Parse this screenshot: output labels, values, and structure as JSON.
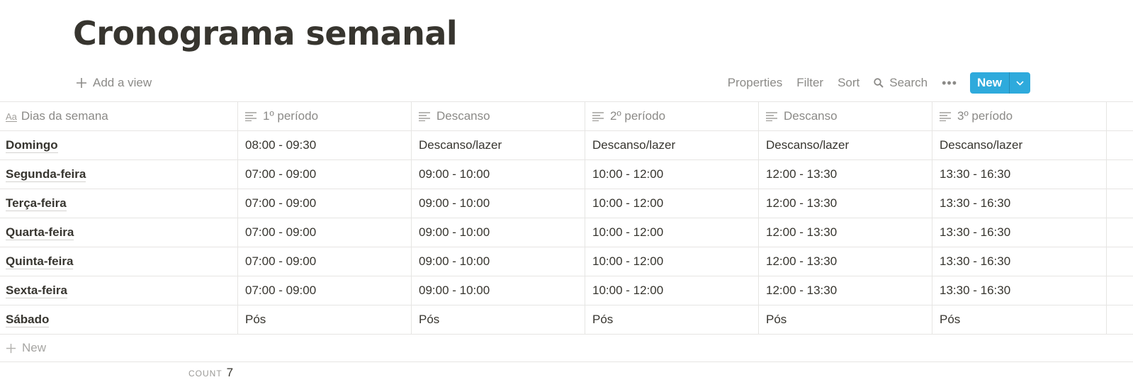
{
  "page": {
    "title": "Cronograma semanal"
  },
  "toolbar": {
    "add_view": "Add a view",
    "properties": "Properties",
    "filter": "Filter",
    "sort": "Sort",
    "search": "Search",
    "more": "•••",
    "new_label": "New",
    "accent_color": "#2eaadc"
  },
  "table": {
    "columns": [
      {
        "label": "Dias da semana",
        "icon": "text-aa-icon"
      },
      {
        "label": "1º período",
        "icon": "text-lines-icon"
      },
      {
        "label": "Descanso",
        "icon": "text-lines-icon"
      },
      {
        "label": "2º período",
        "icon": "text-lines-icon"
      },
      {
        "label": "Descanso",
        "icon": "text-lines-icon"
      },
      {
        "label": "3º período",
        "icon": "text-lines-icon"
      }
    ],
    "rows": [
      [
        "Domingo",
        "08:00 - 09:30",
        "Descanso/lazer",
        "Descanso/lazer",
        "Descanso/lazer",
        "Descanso/lazer"
      ],
      [
        "Segunda-feira",
        "07:00 - 09:00",
        "09:00 - 10:00",
        "10:00 - 12:00",
        "12:00 - 13:30",
        "13:30 - 16:30"
      ],
      [
        "Terça-feira",
        "07:00 - 09:00",
        "09:00 - 10:00",
        "10:00 - 12:00",
        "12:00 - 13:30",
        "13:30 - 16:30"
      ],
      [
        "Quarta-feira",
        "07:00 - 09:00",
        "09:00 - 10:00",
        "10:00 - 12:00",
        "12:00 - 13:30",
        "13:30 - 16:30"
      ],
      [
        "Quinta-feira",
        "07:00 - 09:00",
        "09:00 - 10:00",
        "10:00 - 12:00",
        "12:00 - 13:30",
        "13:30 - 16:30"
      ],
      [
        "Sexta-feira",
        "07:00 - 09:00",
        "09:00 - 10:00",
        "10:00 - 12:00",
        "12:00 - 13:30",
        "13:30 - 16:30"
      ],
      [
        "Sábado",
        "Pós",
        "Pós",
        "Pós",
        "Pós",
        "Pós"
      ]
    ],
    "new_row_label": "New"
  },
  "footer": {
    "count_label": "COUNT",
    "count_value": "7"
  }
}
